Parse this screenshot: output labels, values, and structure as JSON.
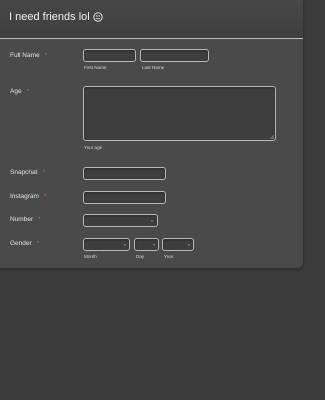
{
  "form": {
    "title": "I need friends lol",
    "title_icon": "smiley-icon"
  },
  "fields": {
    "full_name": {
      "label": "Full Name",
      "required": "*",
      "first_sublabel": "First Name",
      "last_sublabel": "Last Name"
    },
    "age": {
      "label": "Age",
      "required": "*",
      "sublabel": "Your age"
    },
    "snapchat": {
      "label": "Snapchat",
      "required": "*"
    },
    "instagram": {
      "label": "Instagram",
      "required": "*"
    },
    "number": {
      "label": "Number",
      "required": "*"
    },
    "gender": {
      "label": "Gender",
      "required": "*",
      "month_sublabel": "Month",
      "day_sublabel": "Day",
      "year_sublabel": "Year"
    }
  },
  "colors": {
    "background": "#3b3b3b",
    "card": "#4a4a4a",
    "required_star": "#e05a5a",
    "field_border": "#b9b9b9"
  }
}
